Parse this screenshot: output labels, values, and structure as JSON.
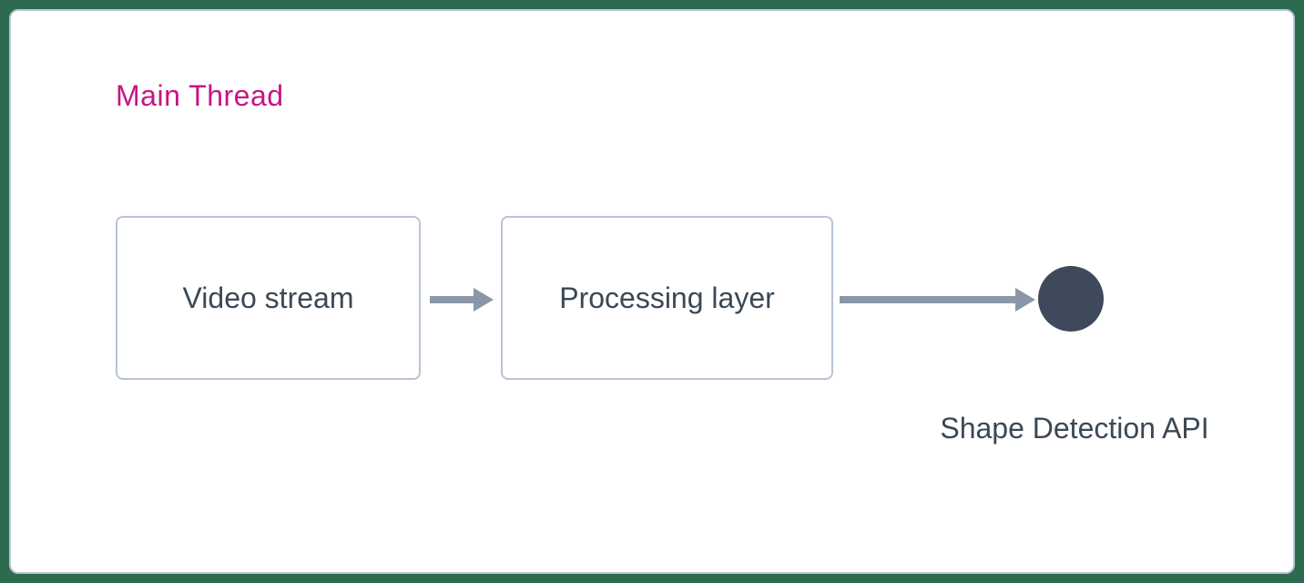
{
  "diagram": {
    "thread_label": "Main Thread",
    "nodes": {
      "video_stream": "Video stream",
      "processing_layer": "Processing layer",
      "shape_api": "Shape Detection API"
    },
    "colors": {
      "outer_bg": "#2d6a4f",
      "panel_bg": "#ffffff",
      "border": "#b8c5d6",
      "label_accent": "#c71585",
      "text": "#3b4856",
      "arrow": "#8a97a8",
      "node_fill": "#3e4a5b"
    }
  }
}
